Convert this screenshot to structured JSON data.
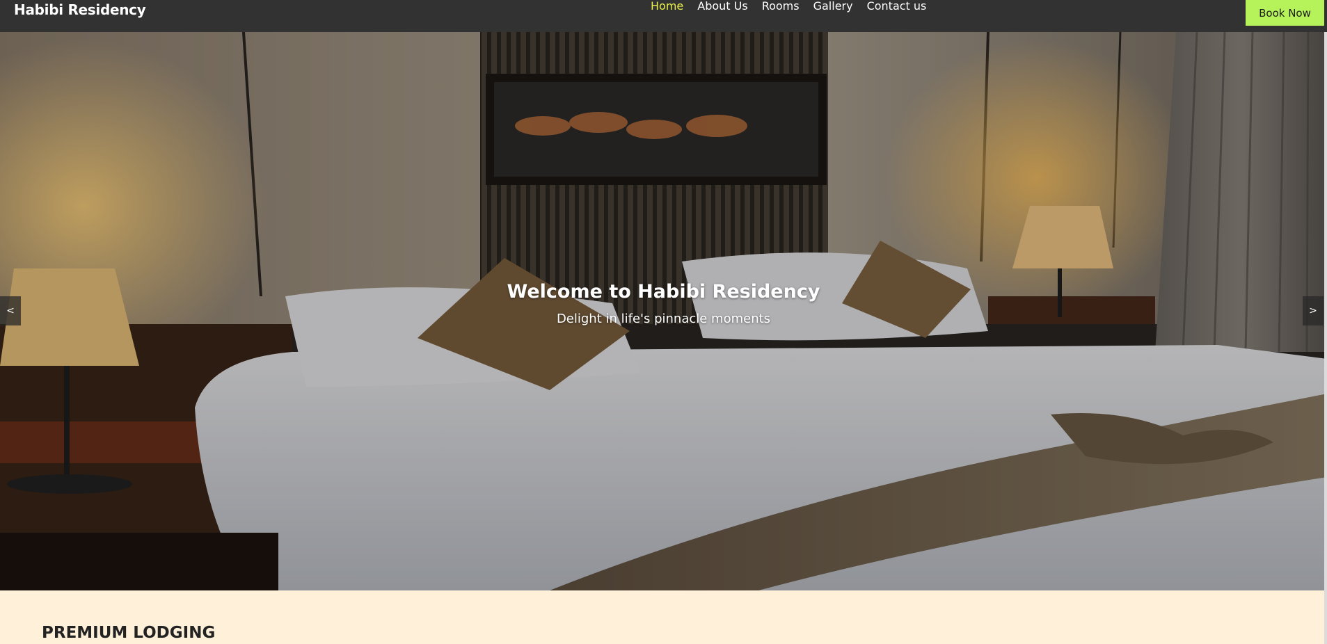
{
  "header": {
    "brand": "Habibi Residency",
    "nav": [
      {
        "label": "Home",
        "active": true
      },
      {
        "label": "About Us",
        "active": false
      },
      {
        "label": "Rooms",
        "active": false
      },
      {
        "label": "Gallery",
        "active": false
      },
      {
        "label": "Contact us",
        "active": false
      }
    ],
    "book_label": "Book Now"
  },
  "hero": {
    "title": "Welcome to Habibi Residency",
    "subtitle": "Delight in life's pinnacle moments",
    "prev_label": "<",
    "next_label": ">"
  },
  "section": {
    "heading": "PREMIUM LODGING"
  },
  "colors": {
    "nav_bg": "#323232",
    "nav_active": "#e8f04a",
    "book_button": "#b6f25a",
    "section_bg": "#fff1d9"
  }
}
